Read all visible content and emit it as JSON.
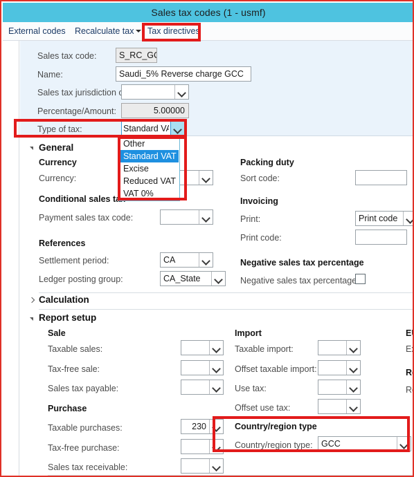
{
  "window": {
    "title": "Sales tax codes (1 - usmf)",
    "titlebar_color": "#4ec3e0",
    "annotation_color": "#e21b1b"
  },
  "action_pane": {
    "tabs": [
      {
        "label": "External codes"
      },
      {
        "label": "Recalculate tax",
        "has_caret": true
      },
      {
        "label": "Tax directives",
        "highlighted": true
      }
    ]
  },
  "header_fields": {
    "sales_tax_code": {
      "label": "Sales tax code:",
      "value": "S_RC_GC",
      "readonly": true
    },
    "name": {
      "label": "Name:",
      "value": "Saudi_5% Reverse charge  GCC"
    },
    "jurisdiction": {
      "label": "Sales tax jurisdiction code:",
      "value": ""
    },
    "percentage": {
      "label": "Percentage/Amount:",
      "value": "5.00000",
      "readonly": true
    },
    "type_of_tax": {
      "label": "Type of tax:",
      "value": "Standard VAT",
      "highlighted": true
    }
  },
  "type_of_tax_dropdown": {
    "open": true,
    "options": [
      {
        "label": "Other",
        "selected": false
      },
      {
        "label": "Standard VAT",
        "selected": true
      },
      {
        "label": "Excise",
        "selected": false
      },
      {
        "label": "Reduced VAT",
        "selected": false
      },
      {
        "label": "VAT 0%",
        "selected": false
      }
    ]
  },
  "general": {
    "title": "General",
    "expanded": true,
    "left": {
      "currency_group": "Currency",
      "currency": {
        "label": "Currency:",
        "value": ""
      },
      "conditional_group": "Conditional sales tax",
      "payment_sales_tax_code": {
        "label": "Payment sales tax code:",
        "value": ""
      },
      "references_group": "References",
      "settlement_period": {
        "label": "Settlement period:",
        "value": "CA"
      },
      "ledger_posting_group": {
        "label": "Ledger posting group:",
        "value": "CA_State"
      }
    },
    "right": {
      "packing_group": "Packing duty",
      "sort_code": {
        "label": "Sort code:",
        "value": ""
      },
      "invoicing_group": "Invoicing",
      "print": {
        "label": "Print:",
        "value": "Print code"
      },
      "print_code": {
        "label": "Print code:",
        "value": ""
      },
      "negative_group": "Negative sales tax percentage",
      "negative_checkbox": {
        "label": "Negative sales tax percentage:",
        "checked": false
      }
    }
  },
  "calculation": {
    "title": "Calculation",
    "expanded": false
  },
  "report_setup": {
    "title": "Report setup",
    "expanded": true,
    "sale": {
      "group": "Sale",
      "fields": [
        {
          "label": "Taxable sales:",
          "value": ""
        },
        {
          "label": "Tax-free sale:",
          "value": ""
        },
        {
          "label": "Sales tax payable:",
          "value": ""
        }
      ]
    },
    "purchase": {
      "group": "Purchase",
      "fields": [
        {
          "label": "Taxable purchases:",
          "value": "230"
        },
        {
          "label": "Tax-free purchase:",
          "value": ""
        },
        {
          "label": "Sales tax receivable:",
          "value": ""
        }
      ]
    },
    "import": {
      "group": "Import",
      "fields": [
        {
          "label": "Taxable import:",
          "value": ""
        },
        {
          "label": "Offset taxable import:",
          "value": ""
        },
        {
          "label": "Use tax:",
          "value": ""
        },
        {
          "label": "Offset use tax:",
          "value": ""
        }
      ]
    },
    "country_region": {
      "group": "Country/region type",
      "field": {
        "label": "Country/region type:",
        "value": "GCC"
      },
      "highlighted": true
    },
    "clipped_right": {
      "eu_group": "EU s",
      "eu_field": "Excl",
      "rep_group": "Rep",
      "rep_field": "Rep"
    }
  }
}
